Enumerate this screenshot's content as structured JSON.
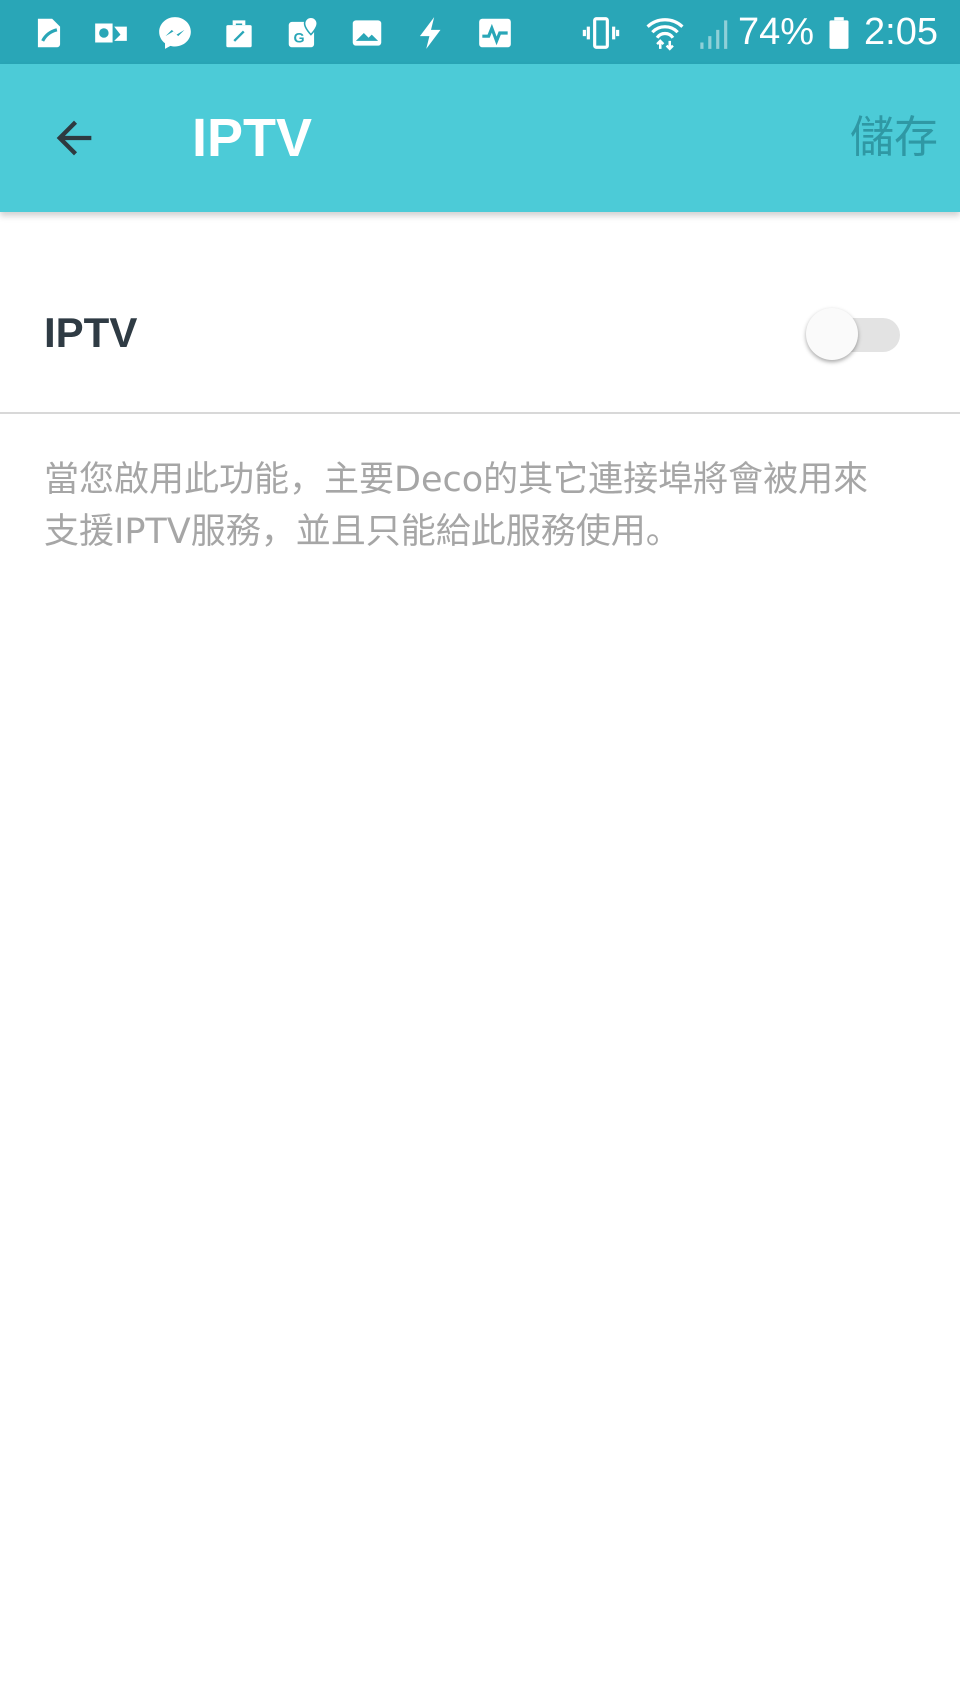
{
  "status_bar": {
    "icons_left": [
      "document-icon",
      "outlook-icon",
      "messenger-icon",
      "shopping-bag-icon",
      "maps-icon",
      "gallery-icon",
      "flash-icon",
      "activity-icon"
    ],
    "icons_right": [
      "vibrate-icon",
      "wifi-icon",
      "cell-signal-icon",
      "battery-icon"
    ],
    "battery_percent": "74%",
    "time": "2:05",
    "background_color": "#29a6b7"
  },
  "app_bar": {
    "title": "IPTV",
    "save_label": "儲存",
    "background_color": "#4ccbd7"
  },
  "setting": {
    "label": "IPTV",
    "enabled": false,
    "description_line1": "當您啟用此功能，主要Deco的其它連接埠將會被用來",
    "description_line2": "支援IPTV服務，並且只能給此服務使用。"
  }
}
